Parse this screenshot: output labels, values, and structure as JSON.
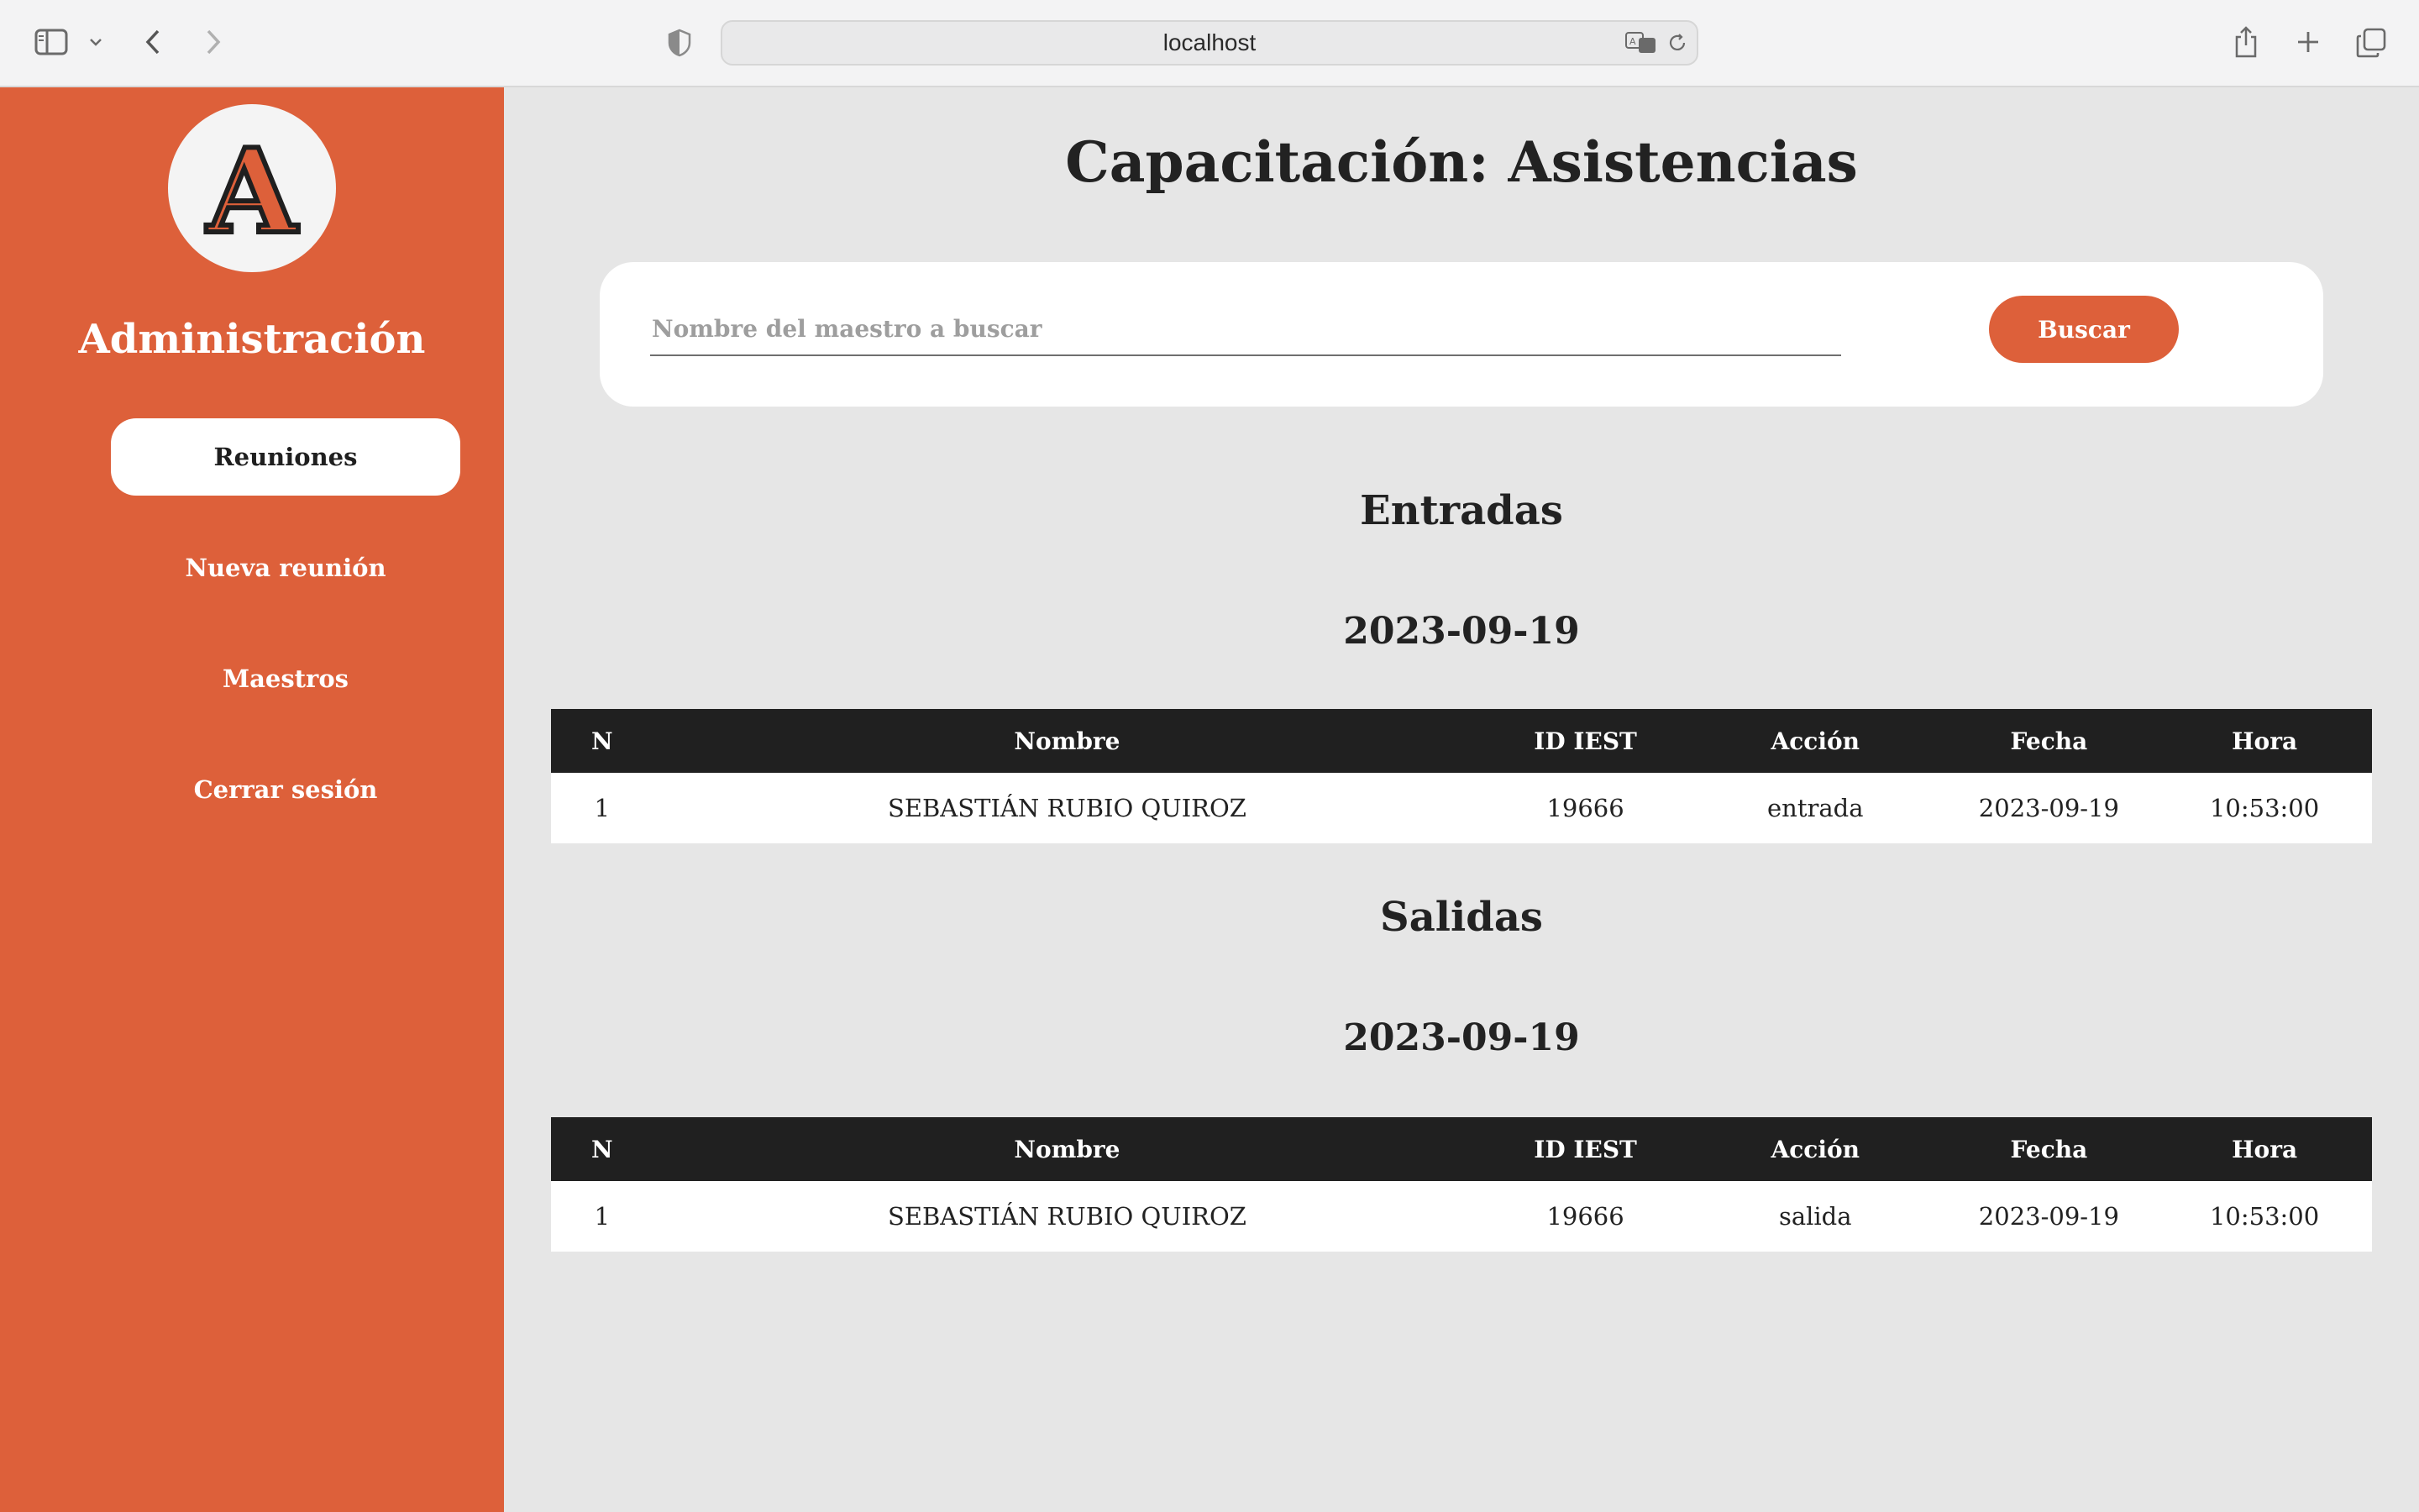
{
  "browser": {
    "url": "localhost"
  },
  "sidebar": {
    "logo_letter": "A",
    "title": "Administración",
    "items": [
      {
        "label": "Reuniones",
        "active": true
      },
      {
        "label": "Nueva reunión",
        "active": false
      },
      {
        "label": "Maestros",
        "active": false
      },
      {
        "label": "Cerrar sesión",
        "active": false
      }
    ]
  },
  "main": {
    "title": "Capacitación: Asistencias",
    "search": {
      "placeholder": "Nombre del maestro a buscar",
      "value": "",
      "button_label": "Buscar"
    },
    "columns": [
      "N",
      "Nombre",
      "ID IEST",
      "Acción",
      "Fecha",
      "Hora"
    ],
    "entradas": {
      "heading": "Entradas",
      "date": "2023-09-19",
      "rows": [
        [
          "1",
          "SEBASTIÁN RUBIO QUIROZ",
          "19666",
          "entrada",
          "2023-09-19",
          "10:53:00"
        ]
      ]
    },
    "salidas": {
      "heading": "Salidas",
      "date": "2023-09-19",
      "rows": [
        [
          "1",
          "SEBASTIÁN RUBIO QUIROZ",
          "19666",
          "salida",
          "2023-09-19",
          "10:53:00"
        ]
      ]
    }
  },
  "colors": {
    "accent": "#dd603a",
    "header_dark": "#202020",
    "background": "#e6e6e6"
  }
}
